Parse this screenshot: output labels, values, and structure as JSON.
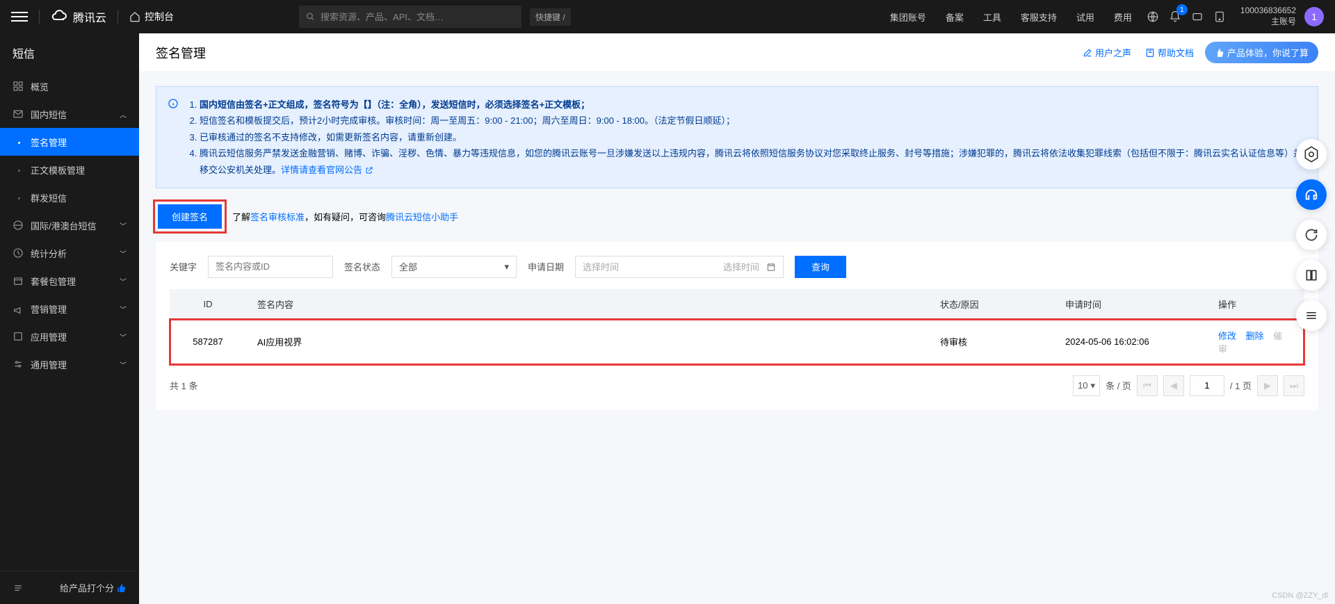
{
  "topbar": {
    "brand": "腾讯云",
    "console": "控制台",
    "search_placeholder": "搜索资源、产品、API、文档…",
    "shortcut": "快捷键 /",
    "nav": [
      "集团账号",
      "备案",
      "工具",
      "客服支持",
      "试用",
      "费用"
    ],
    "notification_count": "1",
    "account_id": "100036836652",
    "account_type": "主账号",
    "avatar_initial": "1"
  },
  "sidebar": {
    "title": "短信",
    "items": {
      "overview": "概览",
      "domestic": "国内短信",
      "signatures": "签名管理",
      "templates": "正文模板管理",
      "bulk": "群发短信",
      "intl": "国际/港澳台短信",
      "stats": "统计分析",
      "package": "套餐包管理",
      "marketing": "营销管理",
      "app": "应用管理",
      "general": "通用管理"
    },
    "rate_label": "给产品打个分"
  },
  "page": {
    "title": "签名管理",
    "user_voice": "用户之声",
    "help_docs": "帮助文档",
    "exp_btn": "产品体验，你说了算"
  },
  "notice": {
    "items": [
      {
        "pre": "国内短信由签名+正文组成，签名符号为【】（注：全角），发送短信时，必须选择签名+正文模板；",
        "bold": true
      },
      {
        "pre": "短信签名和模板提交后，预计2小时完成审核。审核时间：周一至周五：9:00 - 21:00；周六至周日：9:00 - 18:00。（法定节假日顺延）；"
      },
      {
        "pre": "已审核通过的签名不支持修改，如需更新签名内容，请重新创建。"
      },
      {
        "pre": "腾讯云短信服务严禁发送金融营销、赌博、诈骗、淫秽、色情、暴力等违规信息，如您的腾讯云账号一旦涉嫌发送以上违规内容，腾讯云将依照短信服务协议对您采取终止服务、封号等措施；涉嫌犯罪的，腾讯云将依法收集犯罪线索（包括但不限于：腾讯云实名认证信息等）并移交公安机关处理。",
        "link_text": "详情请查看官网公告"
      }
    ]
  },
  "toolbar": {
    "create": "创建签名",
    "hint_pre": "了解",
    "hint_link1": "签名审核标准",
    "hint_mid": "，如有疑问，可咨询",
    "hint_link2": "腾讯云短信小助手"
  },
  "filters": {
    "keyword_label": "关键字",
    "keyword_placeholder": "签名内容或ID",
    "status_label": "签名状态",
    "status_value": "全部",
    "date_label": "申请日期",
    "date_from_placeholder": "选择时间",
    "date_to_placeholder": "选择时间",
    "query": "查询"
  },
  "table": {
    "headers": {
      "id": "ID",
      "content": "签名内容",
      "status": "状态/原因",
      "time": "申请时间",
      "action": "操作"
    },
    "rows": [
      {
        "id": "587287",
        "content": "AI应用视界",
        "status": "待审核",
        "time": "2024-05-06 16:02:06"
      }
    ],
    "actions": {
      "edit": "修改",
      "delete": "删除",
      "urge": "催审"
    }
  },
  "pager": {
    "total_prefix": "共",
    "total_count": "1",
    "total_suffix": "条",
    "page_size": "10",
    "per_page": "条 / 页",
    "current": "1",
    "total_pages": "/ 1 页"
  },
  "watermark": "CSDN @ZZY_dl"
}
